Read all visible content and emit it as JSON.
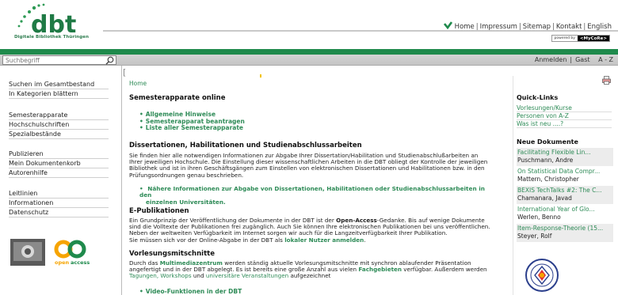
{
  "header": {
    "logo_text": "dbt",
    "logo_subtitle": "Digitale Bibliothek Thüringen",
    "top_links": [
      "Home",
      "Impressum",
      "Sitemap",
      "Kontakt",
      "English"
    ],
    "powered_by": "powered by",
    "powered_brand": "<MyCoRe>"
  },
  "search": {
    "placeholder": "Suchbegriff"
  },
  "user_bar": {
    "login": "Anmelden",
    "guest": "Gast",
    "az": "A - Z"
  },
  "sidebar": {
    "group1": [
      "Suchen im Gesamtbestand",
      "In Kategorien blättern"
    ],
    "group2": [
      "Semesterapparate",
      "Hochschulschriften",
      "Spezialbestände"
    ],
    "group3": [
      "Publizieren",
      "Mein Dokumentenkorb",
      "Autorenhilfe"
    ],
    "group4": [
      "Leitlinien",
      "Informationen",
      "Datenschutz"
    ],
    "logo_text": "open access"
  },
  "main": {
    "breadcrumb": "Home",
    "sec1": {
      "title": "Semesterapparate online",
      "items": [
        "Allgemeine Hinweise",
        "Semesterapparat beantragen",
        "Liste aller Semesterapparate"
      ]
    },
    "sec2": {
      "title": "Dissertationen, Habilitationen und Studienabschlussarbeiten",
      "para_l1": "Sie finden hier alle notwendigen Informationen zur Abgabe Ihrer Dissertation/Habilitation und Studienabschlußarbeiten an",
      "para_l2": "Ihrer jeweiligen Hochschule. Die Einstellung dieser wissenschaftlichen Arbeiten in die DBT obliegt der Kontrolle der jeweiligen",
      "para_l3": "Bibliothek und ist in ihren Geschäftsgängen zum Einstellen von elektronischen Dissertationen und Habilitationen bzw. in den",
      "para_l4": "Prüfungsordnungen genau beschrieben.",
      "link_l1": "Nähere Informationen zur Abgabe von Dissertationen, Habilitationen oder Studienabschlussarbeiten in den",
      "link_l2": "einzelnen Universitäten."
    },
    "sec3": {
      "title": "E-Publikationen",
      "p1a": "Ein Grundprinzip der Veröffentlichung der Dokumente in der DBT ist der ",
      "p1b": "Open-Access",
      "p1c": "-Gedanke. Bis auf wenige Dokumente",
      "l2": "sind die Volltexte der Publikationen frei zugänglich. Auch Sie können Ihre elektronischen Publikationen bei uns veröffentlichen.",
      "l3": "Neben der weltweiten Verfügbarkeit im Internet sorgen wir auch für die Langzeitverfügbarkeit Ihrer Publikation.",
      "l4a": "Sie müssen sich vor der Online-Abgabe in der DBT als ",
      "l4b": "lokaler Nutzer anmelden",
      "l4c": "."
    },
    "sec4": {
      "title": "Vorlesungsmitschnitte",
      "l1a": "Durch das ",
      "l1b": "Multimediazentrum",
      "l1c": " werden ständig aktuelle Vorlesungsmitschnitte mit synchron ablaufender Präsentation",
      "l2a": "angefertigt und in der DBT abgelegt. Es ist bereits eine große Anzahl aus vielen ",
      "l2b": "Fachgebieten",
      "l2c": " verfügbar. Außerdem werden",
      "l3a": "Tagungen, Workshops",
      "l3b": " und ",
      "l3c": "universitäre Veranstaltungen",
      "l3d": " aufgezeichnet",
      "bullet": "Video-Funktionen in der DBT"
    }
  },
  "right": {
    "quick_title": "Quick-Links",
    "quick_links": [
      "Vorlesungen/Kurse",
      "Personen von A-Z",
      "Was ist neu ....?"
    ],
    "new_title": "Neue Dokumente",
    "docs": [
      {
        "title": "Facilitating Flexible Lin...",
        "author": "Puschmann, Andre"
      },
      {
        "title": "On Statistical Data Compr...",
        "author": "Mattern, Christopher"
      },
      {
        "title": "BEXIS TechTalks #2: The C...",
        "author": "Chamanara, Javad"
      },
      {
        "title": "International Year of Glo...",
        "author": "Werlen, Benno"
      },
      {
        "title": "Item-Response-Theorie (15...",
        "author": "Steyer, Rolf"
      }
    ]
  },
  "colors": {
    "accent_green": "#1f8a4c",
    "link_green": "#2e8b57"
  },
  "icons": {
    "home": "home-arrow-icon",
    "search": "magnifier-icon",
    "print": "print-icon"
  }
}
